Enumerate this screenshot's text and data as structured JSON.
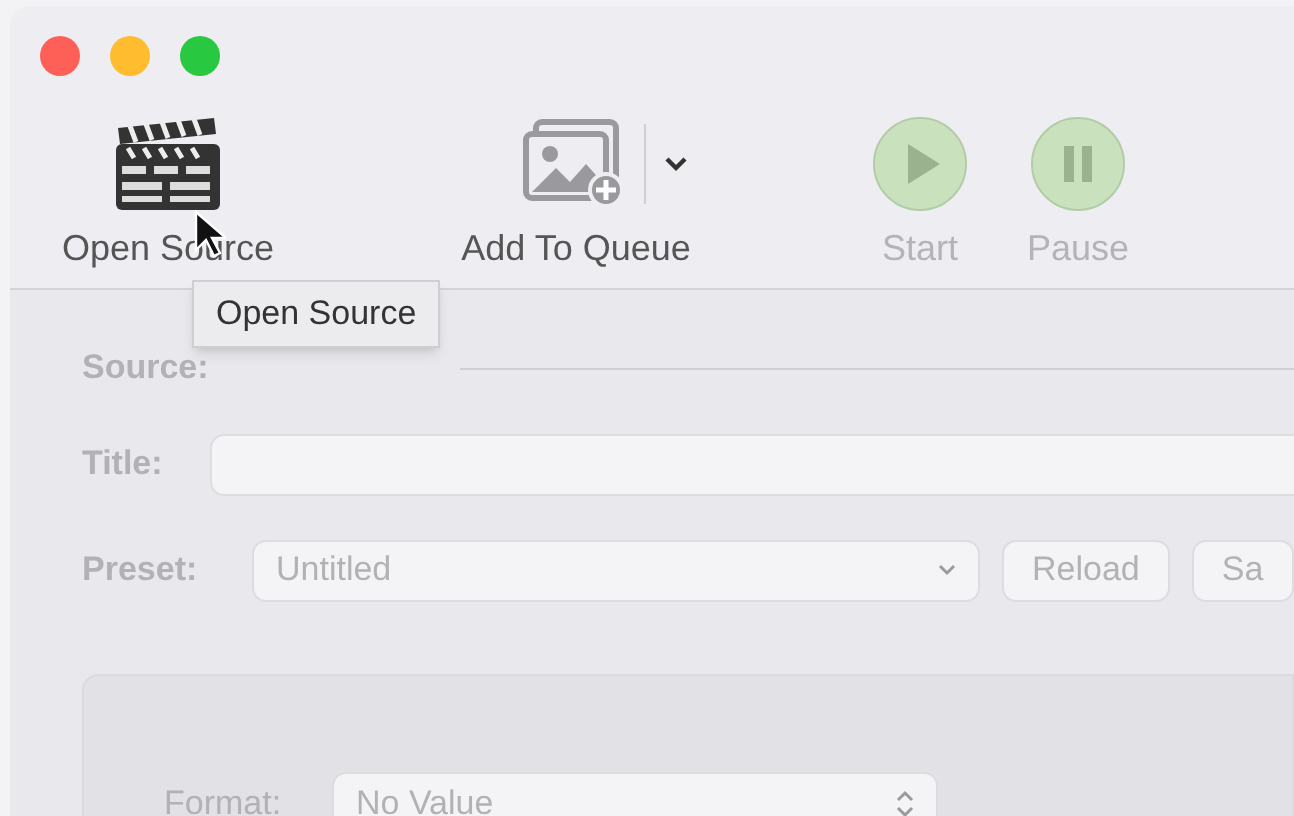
{
  "toolbar": [
    {
      "kind": "open",
      "label": "Open Source",
      "disabled": false
    },
    {
      "kind": "queue",
      "label": "Add To Queue",
      "disabled": false
    },
    {
      "kind": "start",
      "label": "Start",
      "disabled": true
    },
    {
      "kind": "pause",
      "label": "Pause",
      "disabled": true
    }
  ],
  "tooltip": "Open Source",
  "source": {
    "label": "Source:"
  },
  "title_field": {
    "label": "Title:"
  },
  "preset": {
    "label": "Preset:",
    "value": "Untitled",
    "buttons": [
      "Reload",
      "Sa"
    ]
  },
  "format": {
    "label": "Format:",
    "value": "No Value"
  }
}
